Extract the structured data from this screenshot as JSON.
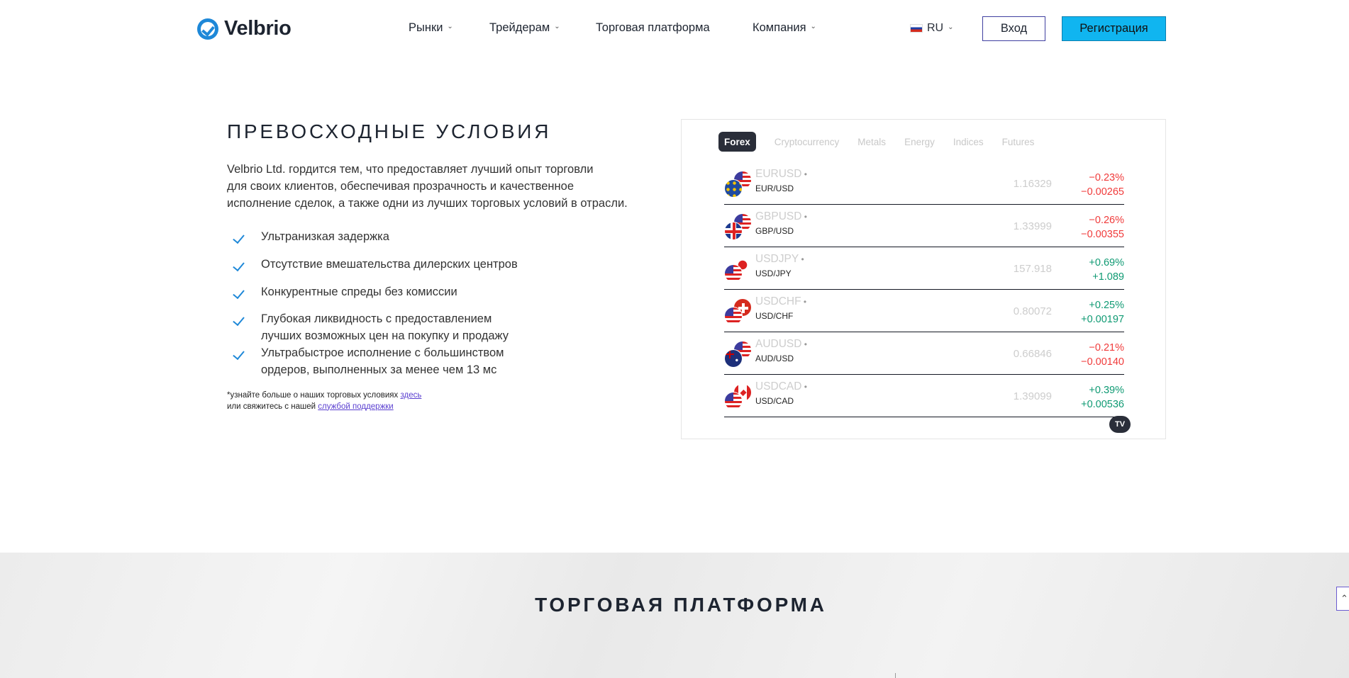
{
  "header": {
    "logo_text": "Velbrio",
    "nav": [
      {
        "label": "Рынки",
        "dropdown": true
      },
      {
        "label": "Трейдерам",
        "dropdown": true
      },
      {
        "label": "Торговая платформа",
        "dropdown": false
      },
      {
        "label": "Компания",
        "dropdown": true
      }
    ],
    "language": "RU",
    "login_label": "Вход",
    "register_label": "Регистрация"
  },
  "conditions": {
    "title": "ПРЕВОСХОДНЫЕ УСЛОВИЯ",
    "intro_lines": [
      "Velbrio Ltd. гордится тем, что предоставляет лучший опыт торговли",
      "для своих клиентов, обеспечивая прозрачность и качественное",
      "исполнение сделок, а также одни из лучших торговых условий в отрасли."
    ],
    "features": [
      [
        "Ультранизкая задержка"
      ],
      [
        "Отсутствие вмешательства дилерских центров"
      ],
      [
        "Конкурентные спреды без комиссии"
      ],
      [
        "Глубокая ликвидность с предоставлением",
        "лучших возможных цен на покупку и продажу"
      ],
      [
        "Ультрабыстрое исполнение с большинством",
        "ордеров, выполненных за менее чем 13 мс"
      ]
    ],
    "note": {
      "line1_text": "*узнайте больше о наших торговых условиях ",
      "line1_link": "здесь",
      "line2_text": "или свяжитесь с нашей ",
      "line2_link": "службой поддержки"
    }
  },
  "widget": {
    "tabs": [
      "Forex",
      "Cryptocurrency",
      "Metals",
      "Energy",
      "Indices",
      "Futures"
    ],
    "active_tab": "Forex",
    "rows": [
      {
        "symbol": "EURUSD",
        "pair": "EUR/USD",
        "price": "1.16329",
        "change_pct": "−0.23%",
        "change": "−0.00265",
        "direction": "down",
        "flags": [
          "eu",
          "us"
        ]
      },
      {
        "symbol": "GBPUSD",
        "pair": "GBP/USD",
        "price": "1.33999",
        "change_pct": "−0.26%",
        "change": "−0.00355",
        "direction": "down",
        "flags": [
          "gb",
          "us"
        ]
      },
      {
        "symbol": "USDJPY",
        "pair": "USD/JPY",
        "price": "157.918",
        "change_pct": "+0.69%",
        "change": "+1.089",
        "direction": "up",
        "flags": [
          "us",
          "jp"
        ]
      },
      {
        "symbol": "USDCHF",
        "pair": "USD/CHF",
        "price": "0.80072",
        "change_pct": "+0.25%",
        "change": "+0.00197",
        "direction": "up",
        "flags": [
          "us",
          "ch"
        ]
      },
      {
        "symbol": "AUDUSD",
        "pair": "AUD/USD",
        "price": "0.66846",
        "change_pct": "−0.21%",
        "change": "−0.00140",
        "direction": "down",
        "flags": [
          "au",
          "us"
        ]
      },
      {
        "symbol": "USDCAD",
        "pair": "USD/CAD",
        "price": "1.39099",
        "change_pct": "+0.39%",
        "change": "+0.00536",
        "direction": "up",
        "flags": [
          "us",
          "ca"
        ]
      }
    ],
    "badge": "TV"
  },
  "platform": {
    "title": "ТОРГОВАЯ ПЛАТФОРМА"
  },
  "colors": {
    "brand_blue": "#1e88d8",
    "register_bg": "#10b5f0",
    "down": "#f03a3a",
    "up": "#0f9a73"
  }
}
